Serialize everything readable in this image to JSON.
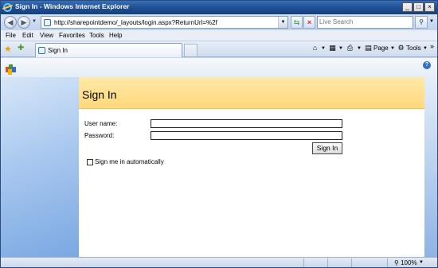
{
  "window": {
    "title": "Sign In - Windows Internet Explorer",
    "controls": [
      "_",
      "□",
      "×"
    ]
  },
  "address_bar": {
    "url": "http://sharepointdemo/_layouts/login.aspx?ReturnUrl=%2f",
    "search_placeholder": "Live Search"
  },
  "menu": [
    "File",
    "Edit",
    "View",
    "Favorites",
    "Tools",
    "Help"
  ],
  "tabs": [
    {
      "label": "Sign In"
    }
  ],
  "command_bar": {
    "page": "Page",
    "tools": "Tools"
  },
  "page": {
    "title": "Sign In",
    "username_label": "User name:",
    "password_label": "Password:",
    "username_value": "",
    "password_value": "",
    "signin_button": "Sign In",
    "remember_label": "Sign me in automatically",
    "remember_checked": false
  },
  "status_bar": {
    "zoom": "100%"
  },
  "colors": {
    "titlebar": "#1f4f95",
    "header_band": "#ffd97b",
    "side_panel": "#a9c8ef"
  }
}
